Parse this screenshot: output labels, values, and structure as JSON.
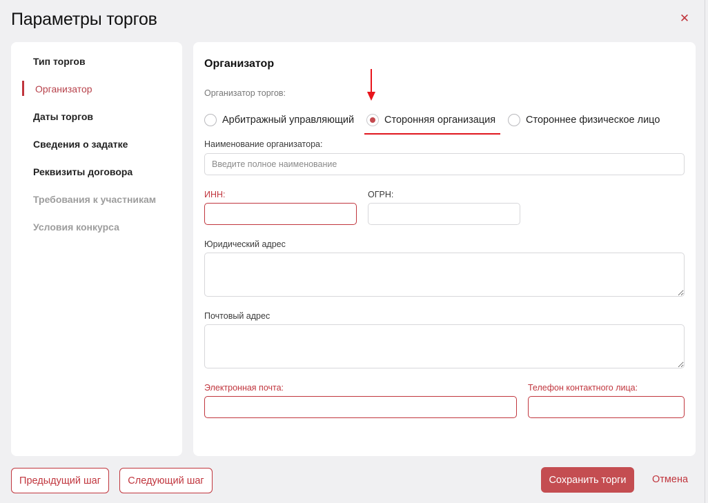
{
  "dialog": {
    "title": "Параметры торгов",
    "close_icon": "close-icon"
  },
  "sidebar": {
    "items": [
      {
        "label": "Тип торгов",
        "state": "normal"
      },
      {
        "label": "Организатор",
        "state": "active"
      },
      {
        "label": "Даты торгов",
        "state": "normal"
      },
      {
        "label": "Сведения о задатке",
        "state": "normal"
      },
      {
        "label": "Реквизиты договора",
        "state": "normal"
      },
      {
        "label": "Требования к участникам",
        "state": "disabled"
      },
      {
        "label": "Условия конкурса",
        "state": "disabled"
      }
    ]
  },
  "form": {
    "section_title": "Организатор",
    "organizer_type_label": "Организатор торгов:",
    "organizer_types": [
      {
        "label": "Арбитражный управляющий",
        "checked": false
      },
      {
        "label": "Сторонняя организация",
        "checked": true
      },
      {
        "label": "Стороннее физическое лицо",
        "checked": false
      }
    ],
    "org_name": {
      "label": "Наименование организатора:",
      "placeholder": "Введите полное наименование",
      "value": ""
    },
    "inn": {
      "label": "ИНН:",
      "value": "",
      "required": true
    },
    "ogrn": {
      "label": "ОГРН:",
      "value": ""
    },
    "legal_address": {
      "label": "Юридический адрес",
      "value": ""
    },
    "postal_address": {
      "label": "Почтовый адрес",
      "value": ""
    },
    "email": {
      "label": "Электронная почта:",
      "value": "",
      "required": true
    },
    "phone": {
      "label": "Телефон контактного лица:",
      "value": "",
      "required": true
    }
  },
  "footer": {
    "prev_label": "Предыдущий шаг",
    "next_label": "Следующий шаг",
    "save_label": "Сохранить торги",
    "cancel_label": "Отмена"
  },
  "colors": {
    "accent": "#c0353d",
    "annotation": "#e8141b",
    "background": "#f0f0f2"
  }
}
